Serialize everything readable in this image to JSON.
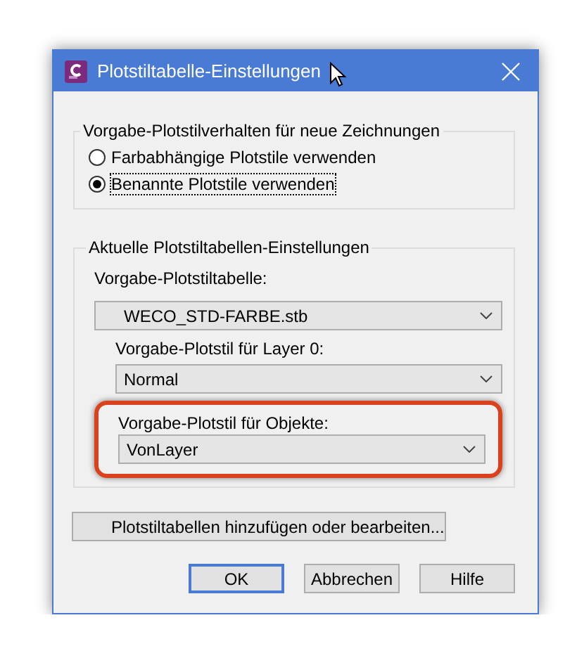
{
  "window": {
    "title": "Plotstiltabelle-Einstellungen"
  },
  "behaviour_group": {
    "legend": "Vorgabe-Plotstilverhalten für neue Zeichnungen",
    "options": [
      {
        "label": "Farbabhängige Plotstile verwenden",
        "selected": false
      },
      {
        "label": "Benannte Plotstile verwenden",
        "selected": true
      }
    ]
  },
  "settings_group": {
    "legend": "Aktuelle Plotstiltabellen-Einstellungen",
    "fields": [
      {
        "label": "Vorgabe-Plotstiltabelle:",
        "value": "WECO_STD-FARBE.stb",
        "highlighted": false
      },
      {
        "label": "Vorgabe-Plotstil für Layer 0:",
        "value": "Normal",
        "highlighted": false
      },
      {
        "label": "Vorgabe-Plotstil für Objekte:",
        "value": "VonLayer",
        "highlighted": true
      }
    ]
  },
  "edit_button": "Plotstiltabellen hinzufügen oder bearbeiten...",
  "buttons": [
    {
      "label": "OK",
      "default": true
    },
    {
      "label": "Abbrechen",
      "default": false
    },
    {
      "label": "Hilfe",
      "default": false
    }
  ]
}
